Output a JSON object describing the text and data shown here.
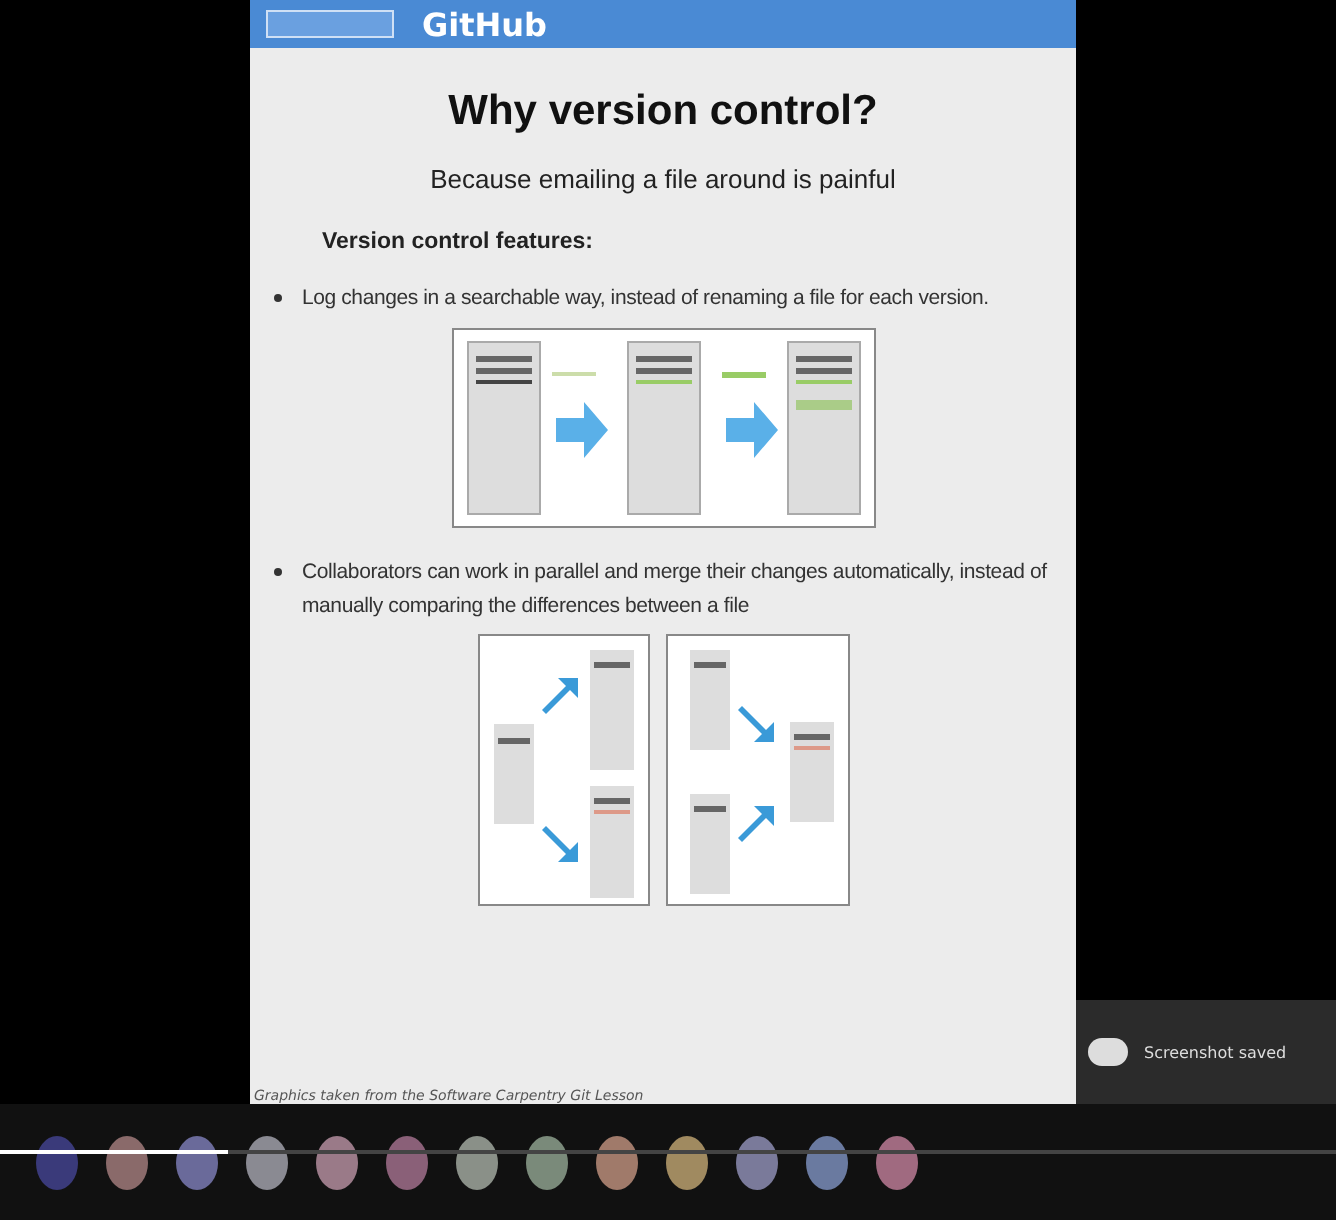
{
  "slide": {
    "header_title": "GitHub",
    "title": "Why version control?",
    "subtitle": "Because emailing a file around is painful",
    "section_heading": "Version control features:",
    "bullets": [
      {
        "text": "Log changes in a searchable way, instead of renaming a file for each version.",
        "kind": "linear"
      },
      {
        "text": "Collaborators can work in parallel and merge their changes automatically, instead of manually comparing the differences between a file",
        "kind": "merge"
      }
    ],
    "footnote": "Graphics taken from the Software Carpentry Git Lesson"
  },
  "notification": {
    "title": "Screenshot saved"
  },
  "player": {
    "level": 0.17
  },
  "participants": [
    {
      "color": "#3a3a7a"
    },
    {
      "color": "#8a6a6a"
    },
    {
      "color": "#6a6a9a"
    },
    {
      "color": "#8a8a92"
    },
    {
      "color": "#9a7a88"
    },
    {
      "color": "#8a6078"
    },
    {
      "color": "#8a9088"
    },
    {
      "color": "#7a8a7a"
    },
    {
      "color": "#a07a6a"
    },
    {
      "color": "#a08a60"
    },
    {
      "color": "#7a7a9a"
    },
    {
      "color": "#6a7aa0"
    },
    {
      "color": "#a06a80"
    }
  ]
}
